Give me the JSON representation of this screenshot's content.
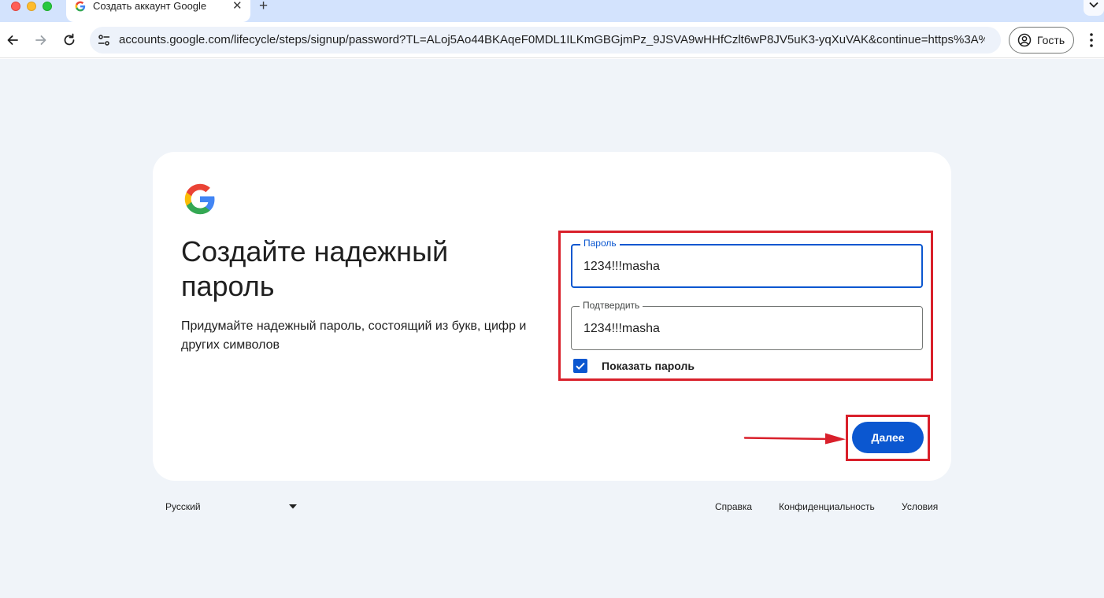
{
  "browser": {
    "tab_title": "Создать аккаунт Google",
    "tab_close_glyph": "✕",
    "new_tab_glyph": "+",
    "url": "accounts.google.com/lifecycle/steps/signup/password?TL=ALoj5Ao44BKAqeF0MDL1ILKmGBGjmPz_9JSVA9wHHfCzlt6wP8JV5uK3-yqXuVAK&continue=https%3A%...",
    "profile_label": "Гость"
  },
  "card": {
    "headline": "Создайте надежный пароль",
    "subtext": "Придумайте надежный пароль, состоящий из букв, цифр и других символов",
    "password_field": {
      "label": "Пароль",
      "value": "1234!!!masha"
    },
    "confirm_field": {
      "label": "Подтвердить",
      "value": "1234!!!masha"
    },
    "show_password": {
      "label": "Показать пароль",
      "checked": true
    },
    "next_label": "Далее"
  },
  "footer": {
    "language": "Русский",
    "links": [
      "Справка",
      "Конфиденциальность",
      "Условия"
    ]
  },
  "colors": {
    "accent": "#0b57d0",
    "annotation_red": "#d9202b",
    "page_bg": "#f0f4f9",
    "tabstrip_bg": "#d3e3fd"
  },
  "icons": {
    "back": "arrow-left-icon",
    "forward": "arrow-right-icon",
    "reload": "reload-icon",
    "site_info": "tune-icon",
    "profile": "account-circle-icon",
    "menu": "kebab-icon",
    "logo": "google-g-logo"
  }
}
